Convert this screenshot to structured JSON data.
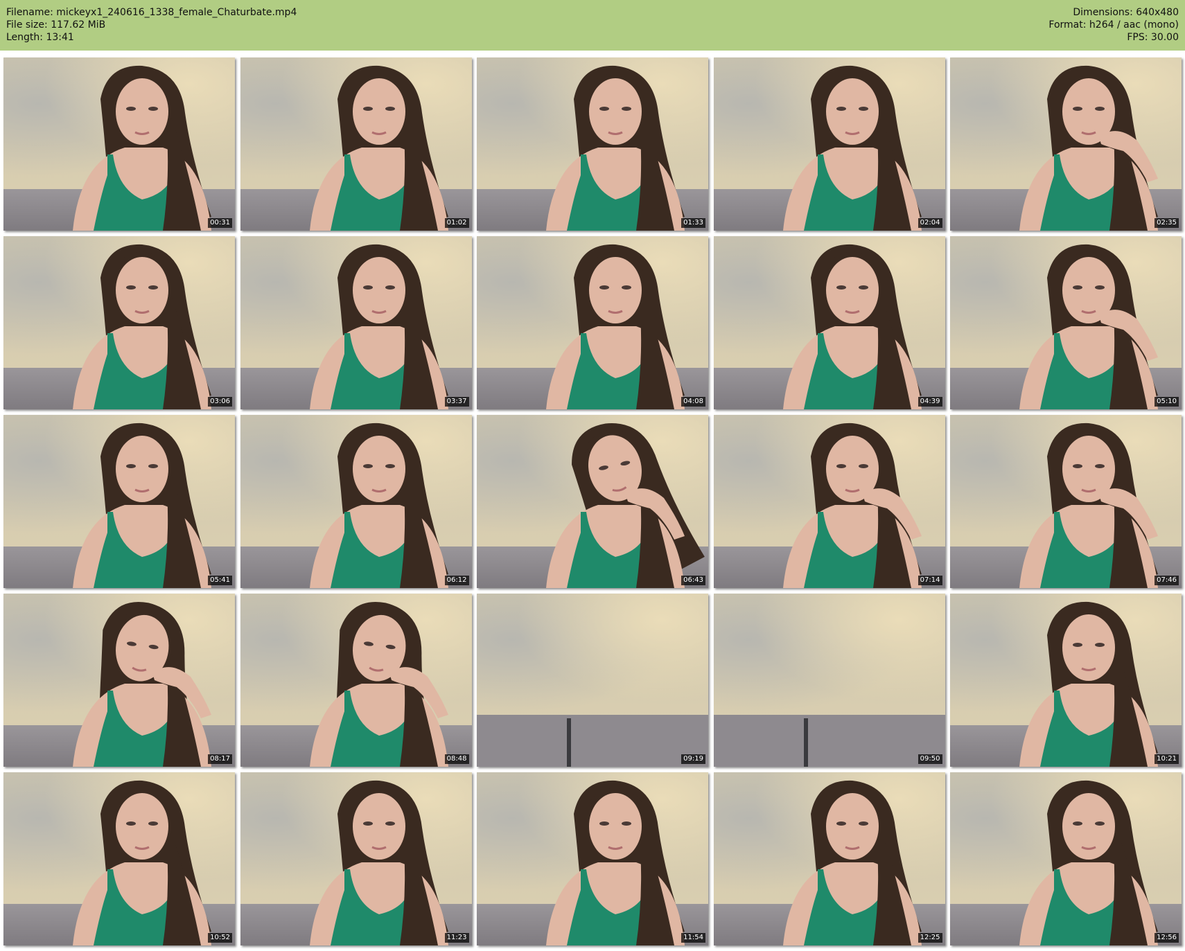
{
  "header": {
    "filename": "Filename: mickeyx1_240616_1338_female_Chaturbate.mp4",
    "filesize": "File size: 117.62 MiB",
    "length": "Length: 13:41",
    "dimensions": "Dimensions: 640x480",
    "format": "Format: h264 / aac (mono)",
    "fps": "FPS: 30.00"
  },
  "colors": {
    "header_bg": "#b1cd83",
    "tank_top": "#1f8a6a",
    "hair": "#3a2a20",
    "skin": "#e0b7a3"
  },
  "thumbnails": [
    {
      "time": "00:31",
      "scene": "person"
    },
    {
      "time": "01:02",
      "scene": "person"
    },
    {
      "time": "01:33",
      "scene": "person"
    },
    {
      "time": "02:04",
      "scene": "person"
    },
    {
      "time": "02:35",
      "scene": "person-hand"
    },
    {
      "time": "03:06",
      "scene": "person"
    },
    {
      "time": "03:37",
      "scene": "person"
    },
    {
      "time": "04:08",
      "scene": "person"
    },
    {
      "time": "04:39",
      "scene": "person"
    },
    {
      "time": "05:10",
      "scene": "person-hand"
    },
    {
      "time": "05:41",
      "scene": "person"
    },
    {
      "time": "06:12",
      "scene": "person"
    },
    {
      "time": "06:43",
      "scene": "person-tilt"
    },
    {
      "time": "07:14",
      "scene": "person-hand"
    },
    {
      "time": "07:46",
      "scene": "person-hand"
    },
    {
      "time": "08:17",
      "scene": "person-lean"
    },
    {
      "time": "08:48",
      "scene": "person-lean"
    },
    {
      "time": "09:19",
      "scene": "empty"
    },
    {
      "time": "09:50",
      "scene": "empty"
    },
    {
      "time": "10:21",
      "scene": "person"
    },
    {
      "time": "10:52",
      "scene": "person"
    },
    {
      "time": "11:23",
      "scene": "person"
    },
    {
      "time": "11:54",
      "scene": "person"
    },
    {
      "time": "12:25",
      "scene": "person"
    },
    {
      "time": "12:56",
      "scene": "person"
    }
  ]
}
